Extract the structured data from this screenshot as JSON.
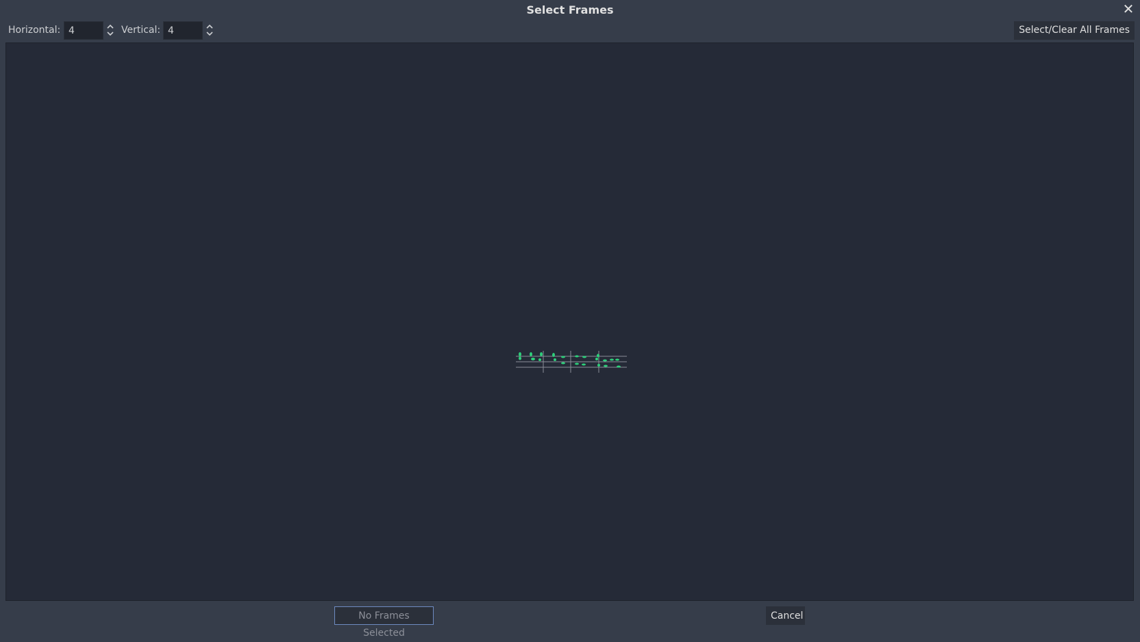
{
  "dialog": {
    "title": "Select Frames",
    "close_icon": "close-icon"
  },
  "toolbar": {
    "horizontal_label": "Horizontal:",
    "horizontal_value": "4",
    "vertical_label": "Vertical:",
    "vertical_value": "4",
    "select_all_label": "Select/Clear All Frames"
  },
  "footer": {
    "confirm_label": "No Frames Selected",
    "cancel_label": "Cancel"
  },
  "colors": {
    "background": "#363d4a",
    "canvas": "#252a37",
    "accent": "#6e8bc2",
    "sprite_green": "#2ecf7a"
  }
}
